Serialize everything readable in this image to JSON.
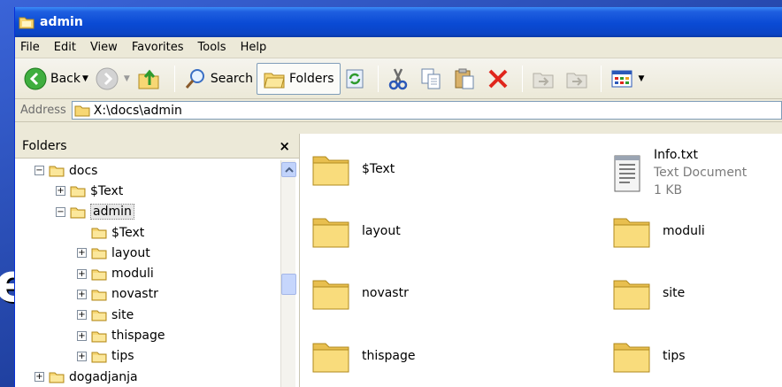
{
  "window": {
    "title": "admin"
  },
  "menu": [
    "File",
    "Edit",
    "View",
    "Favorites",
    "Tools",
    "Help"
  ],
  "toolbar": {
    "back_label": "Back",
    "search_label": "Search",
    "folders_label": "Folders"
  },
  "address": {
    "label": "Address",
    "value": "X:\\docs\\admin"
  },
  "folders_pane": {
    "title": "Folders",
    "close_glyph": "×",
    "tree": [
      {
        "label": "docs",
        "expander": "−",
        "level": 0
      },
      {
        "label": "$Text",
        "expander": "+",
        "level": 1
      },
      {
        "label": "admin",
        "expander": "−",
        "level": 1,
        "selected": true
      },
      {
        "label": "$Text",
        "expander": "",
        "level": 2
      },
      {
        "label": "layout",
        "expander": "+",
        "level": 2
      },
      {
        "label": "moduli",
        "expander": "+",
        "level": 2
      },
      {
        "label": "novastr",
        "expander": "+",
        "level": 2
      },
      {
        "label": "site",
        "expander": "+",
        "level": 2
      },
      {
        "label": "thispage",
        "expander": "+",
        "level": 2
      },
      {
        "label": "tips",
        "expander": "+",
        "level": 2
      },
      {
        "label": "dogadjanja",
        "expander": "+",
        "level": 0
      }
    ]
  },
  "files": [
    {
      "name": "$Text",
      "type": "folder"
    },
    {
      "name": "Info.txt",
      "type": "text",
      "kind": "Text Document",
      "size": "1 KB"
    },
    {
      "name": "layout",
      "type": "folder"
    },
    {
      "name": "moduli",
      "type": "folder"
    },
    {
      "name": "novastr",
      "type": "folder"
    },
    {
      "name": "site",
      "type": "folder"
    },
    {
      "name": "thispage",
      "type": "folder"
    },
    {
      "name": "tips",
      "type": "folder"
    }
  ],
  "background": {
    "slide_letter": "e"
  },
  "colors": {
    "titlebar": "#0a4ad4",
    "folder": "#f7d774",
    "chrome": "#ece9d8"
  }
}
